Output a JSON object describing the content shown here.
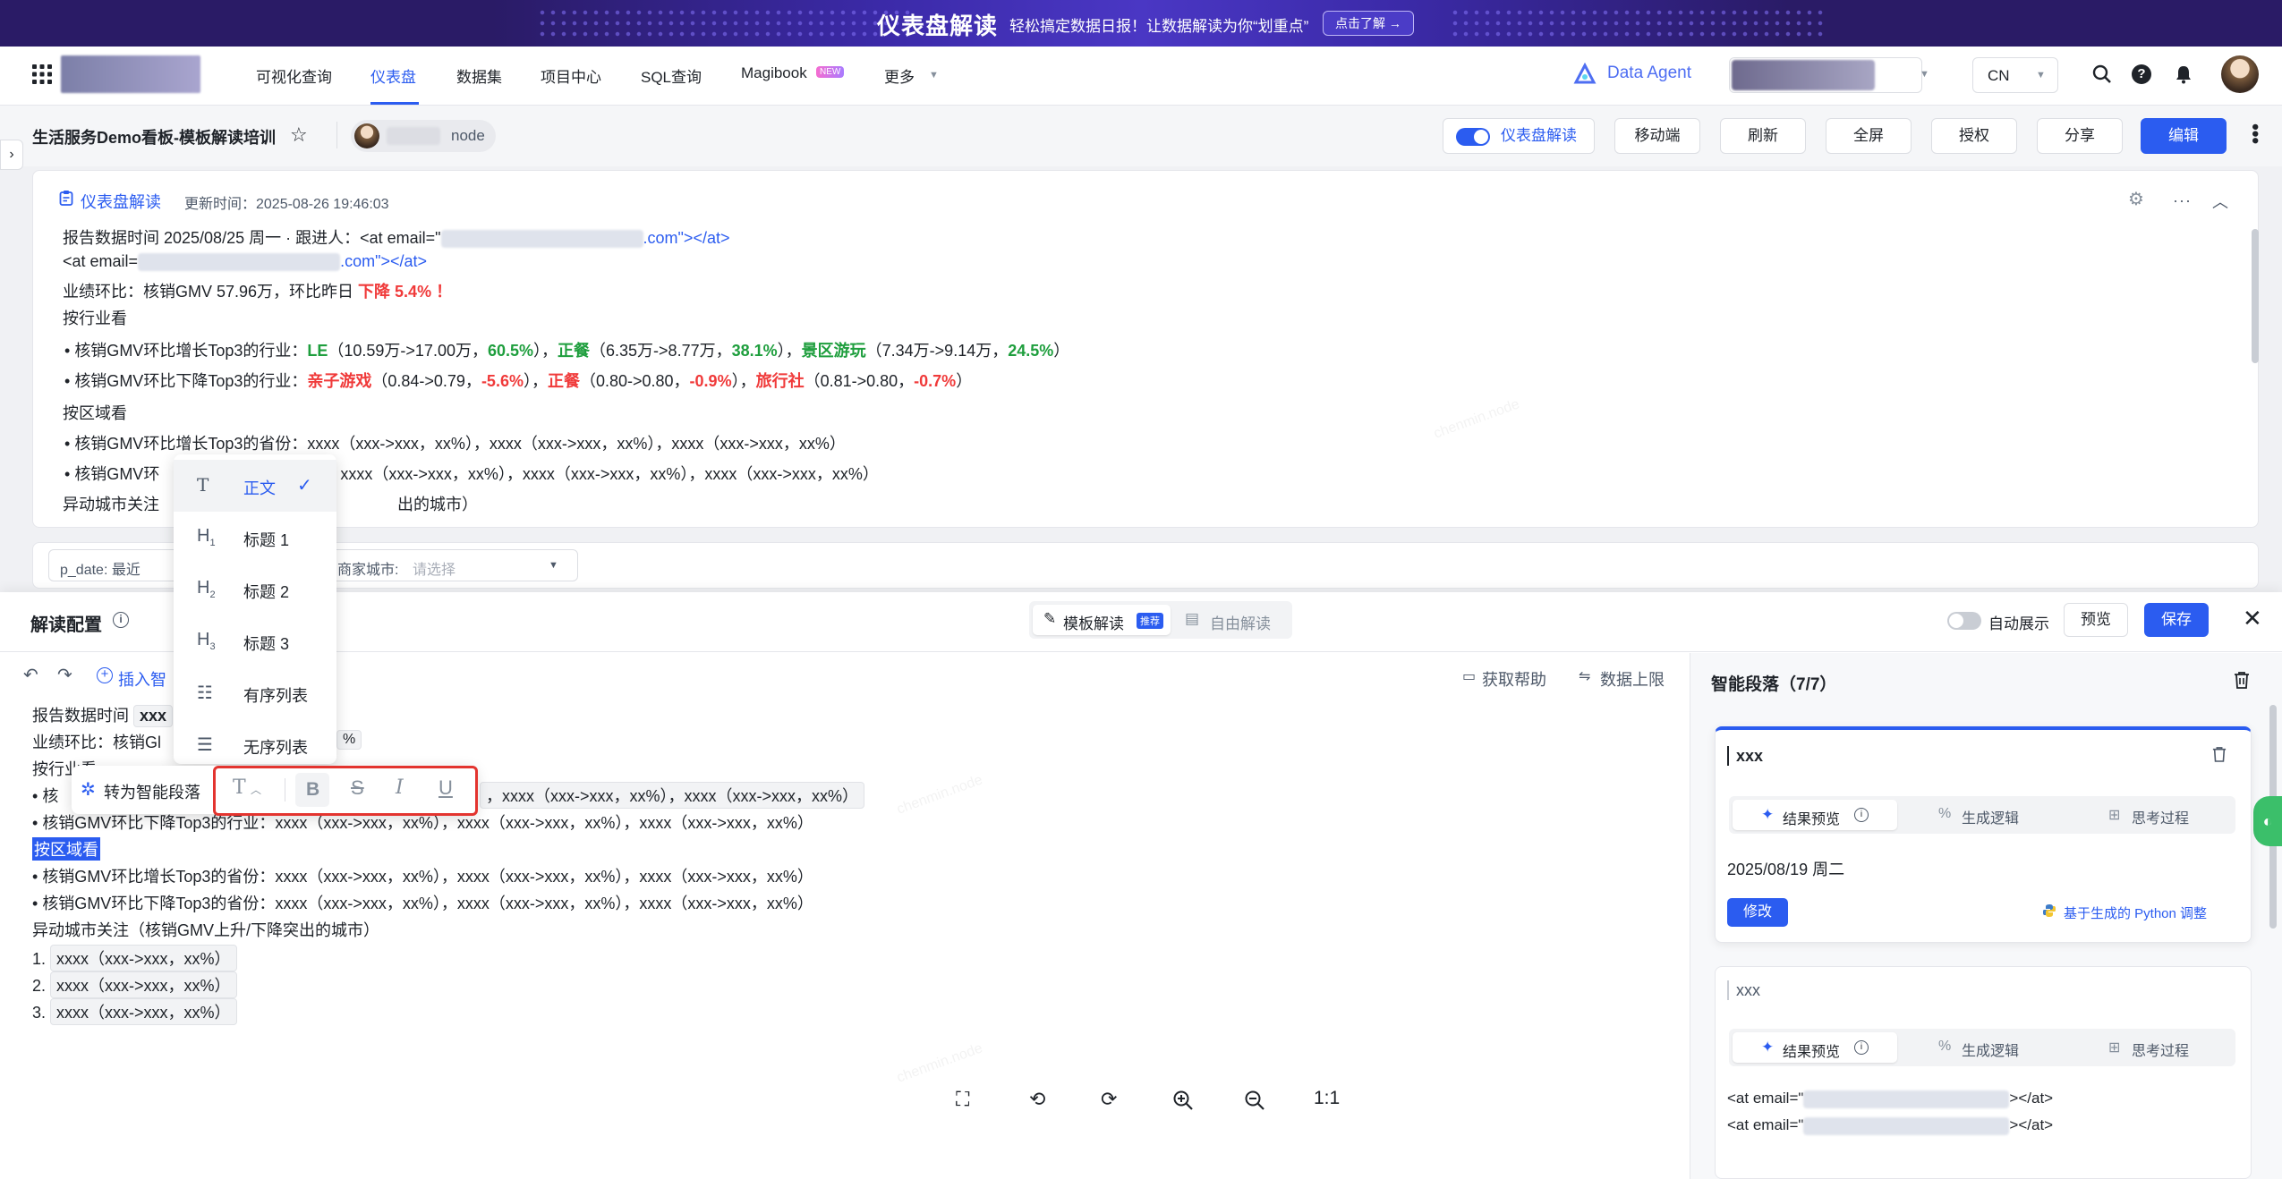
{
  "banner": {
    "title": "仪表盘解读",
    "subtitle": "轻松搞定数据日报！让数据解读为你“划重点”",
    "button": "点击了解 →"
  },
  "nav": {
    "items": [
      "可视化查询",
      "仪表盘",
      "数据集",
      "项目中心",
      "SQL查询",
      "Magibook",
      "更多"
    ],
    "active": "仪表盘",
    "magibook_badge": "NEW",
    "data_agent": "Data Agent",
    "lang": "CN"
  },
  "header": {
    "title": "生活服务Demo看板-模板解读培训",
    "owner": "node",
    "toggle_label": "仪表盘解读",
    "buttons": [
      "移动端",
      "刷新",
      "全屏",
      "授权",
      "分享"
    ],
    "primary_button": "编辑"
  },
  "card": {
    "label": "仪表盘解读",
    "updated": "更新时间：2025-08-26 19:46:03",
    "line1_prefix": "报告数据时间 2025/08/25 周一 · 跟进人：<at email=\"",
    "line1_suffix": ".com\"></at>",
    "line2_prefix": "<at email=",
    "line2_suffix": ".com\"></at>",
    "perf_prefix": "业绩环比：核销GMV 57.96万，环比昨日 ",
    "perf_value": "下降 5.4% ！",
    "by_industry": "按行业看",
    "ind_up_prefix": "核销GMV环比增长Top3的行业：",
    "ind_up": [
      {
        "name": "LE",
        "range": "（10.59万->17.00万，",
        "pct": "60.5%",
        "end": "），"
      },
      {
        "name": "正餐",
        "range": "（6.35万->8.77万，",
        "pct": "38.1%",
        "end": "），"
      },
      {
        "name": "景区游玩",
        "range": "（7.34万->9.14万，",
        "pct": "24.5%",
        "end": "）"
      }
    ],
    "ind_down_prefix": "核销GMV环比下降Top3的行业：",
    "ind_down": [
      {
        "name": "亲子游戏",
        "range": "（0.84->0.79，",
        "pct": "-5.6%",
        "end": "），"
      },
      {
        "name": "正餐",
        "range": "（0.80->0.80，",
        "pct": "-0.9%",
        "end": "），"
      },
      {
        "name": "旅行社",
        "range": "（0.81->0.80，",
        "pct": "-0.7%",
        "end": "）"
      }
    ],
    "by_region": "按区域看",
    "reg_up": "核销GMV环比增长Top3的省份：xxxx（xxx->xxx，xx%），xxxx（xxx->xxx，xx%），xxxx（xxx->xxx，xx%）",
    "reg_down_prefix": "核销GMV环",
    "reg_down_suffix": "xxxx（xxx->xxx，xx%），xxxx（xxx->xxx，xx%），xxxx（xxx->xxx，xx%）",
    "abnormal_prefix": "异动城市关注",
    "abnormal_suffix": "出的城市）"
  },
  "filters": {
    "date_label": "p_date: 最近",
    "city_label": "商家城市:",
    "city_placeholder": "请选择"
  },
  "panel": {
    "title": "解读配置",
    "seg_template": "模板解读",
    "seg_template_badge": "推荐",
    "seg_free": "自由解读",
    "auto_show": "自动展示",
    "preview": "预览",
    "save": "保存",
    "insert": "插入智",
    "help": "获取帮助",
    "data_limit": "数据上限"
  },
  "editor": {
    "l1": "报告数据时间",
    "l1_chip": "xxx",
    "l2": "业绩环比：核销Gl",
    "l3": "按行业看",
    "l4_prefix": "核",
    "l4_suffix": "，xxxx（xxx->xxx，xx%），xxxx（xxx->xxx，xx%）",
    "l5": "核销GMV环比下降Top3的行业：xxxx（xxx->xxx，xx%），xxxx（xxx->xxx，xx%），xxxx（xxx->xxx，xx%）",
    "l6": "按区域看",
    "l7": "核销GMV环比增长Top3的省份：xxxx（xxx->xxx，xx%），xxxx（xxx->xxx，xx%），xxxx（xxx->xxx，xx%）",
    "l8": "核销GMV环比下降Top3的省份：xxxx（xxx->xxx，xx%），xxxx（xxx->xxx，xx%），xxxx（xxx->xxx，xx%）",
    "l9": "异动城市关注（核销GMV上升/下降突出的城市）",
    "list": [
      "xxxx（xxx->xxx，xx%）",
      "xxxx（xxx->xxx，xx%）",
      "xxxx（xxx->xxx，xx%）"
    ]
  },
  "dropdown": [
    {
      "icon": "T",
      "label": "正文",
      "checked": true
    },
    {
      "icon": "H1",
      "label": "标题 1"
    },
    {
      "icon": "H2",
      "label": "标题 2"
    },
    {
      "icon": "H3",
      "label": "标题 3"
    },
    {
      "icon": "ol",
      "label": "有序列表"
    },
    {
      "icon": "ul",
      "label": "无序列表"
    }
  ],
  "floatbar": {
    "convert": "转为智能段落"
  },
  "side": {
    "title": "智能段落（7/7）",
    "card1_title": "xxx",
    "tab_preview": "结果预览",
    "tab_logic": "生成逻辑",
    "tab_thinking": "思考过程",
    "card1_date": "2025/08/19 周二",
    "modify": "修改",
    "python_link": "基于生成的 Python 调整",
    "card2_title": "xxx",
    "card2_line1_prefix": "<at email=\"",
    "card2_line1_suffix": "></at>",
    "card2_line2_prefix": "<at email=\"",
    "card2_line2_suffix": "></at>"
  },
  "viewer": {
    "zoom_reset": "1:1"
  },
  "colors": {
    "primary": "#2b5cf0",
    "green": "#1e9e3d",
    "red": "#f03a3a",
    "banner_bg": "#2a1b66"
  }
}
